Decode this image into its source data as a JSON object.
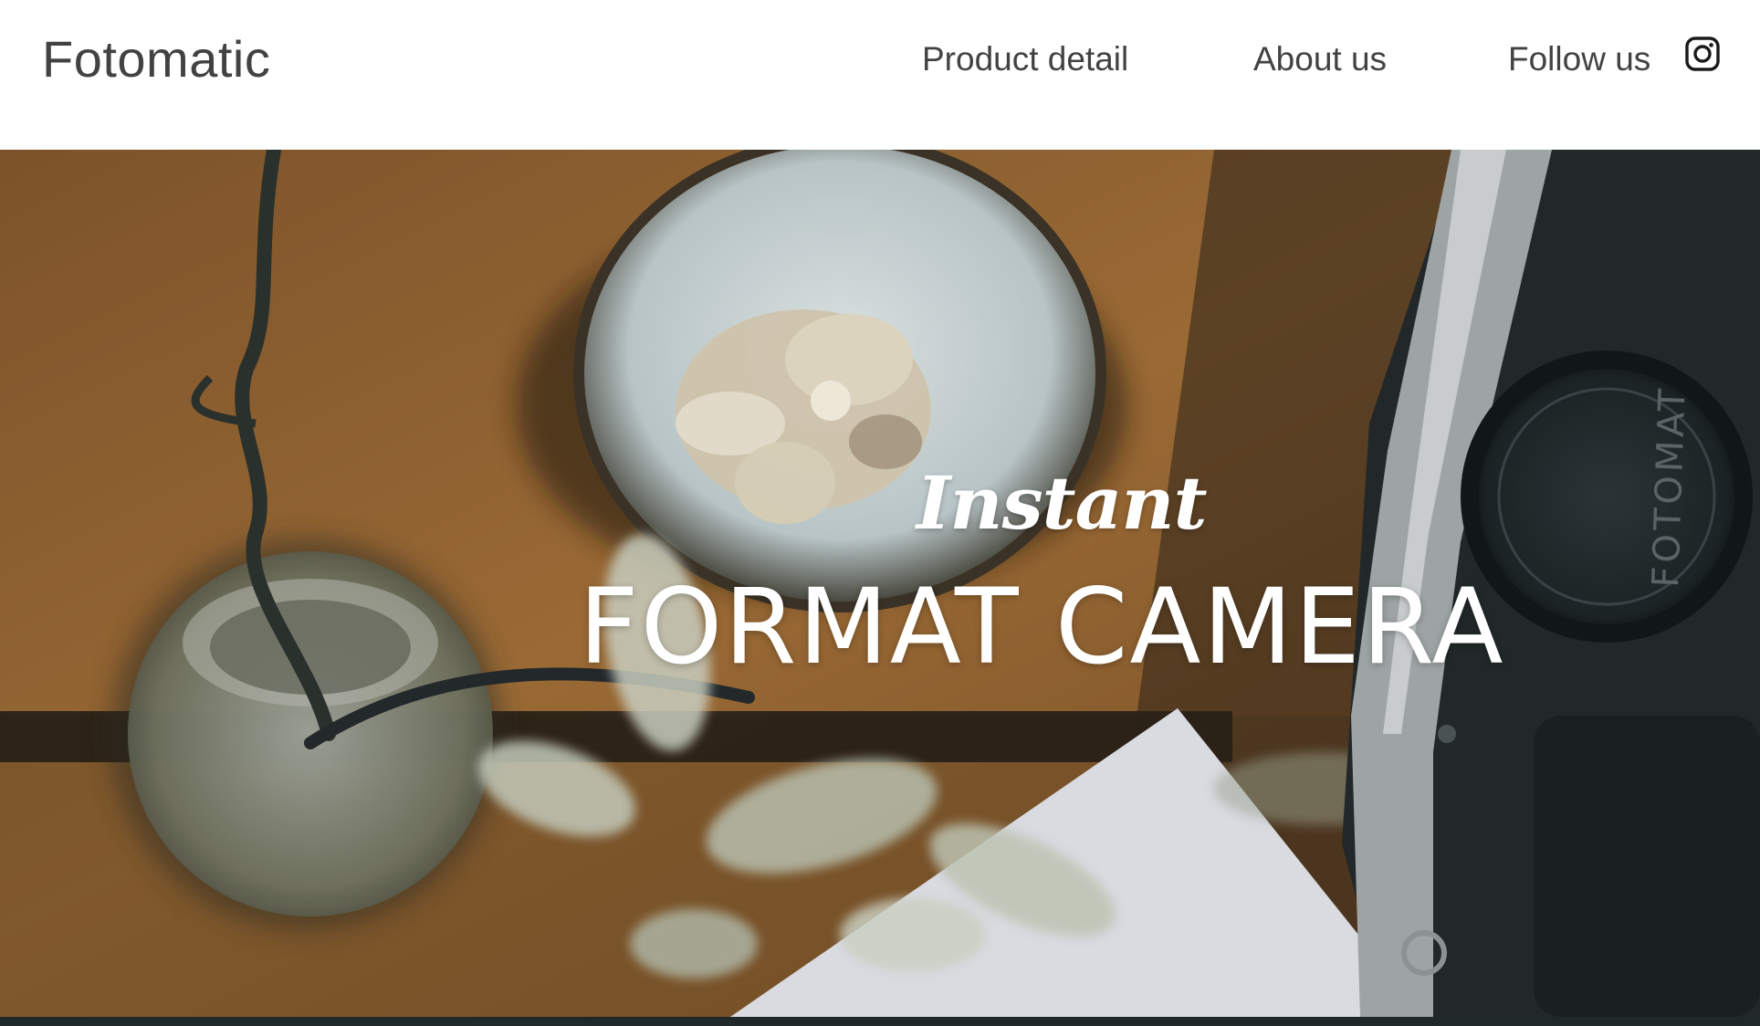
{
  "header": {
    "brand": "Fotomatic",
    "nav": [
      {
        "label": "Product detail"
      },
      {
        "label": "About us"
      },
      {
        "label": "Follow us"
      }
    ],
    "social_icon": "instagram-icon"
  },
  "hero": {
    "script_text": "Instant",
    "title": "FORMAT CAMERA",
    "lens_cap_text": "FOTOMAT"
  },
  "colors": {
    "text_dark": "#424242",
    "hero_text": "#ffffff",
    "wood": "#8a5e2e",
    "bottom_strip": "#20282a"
  }
}
